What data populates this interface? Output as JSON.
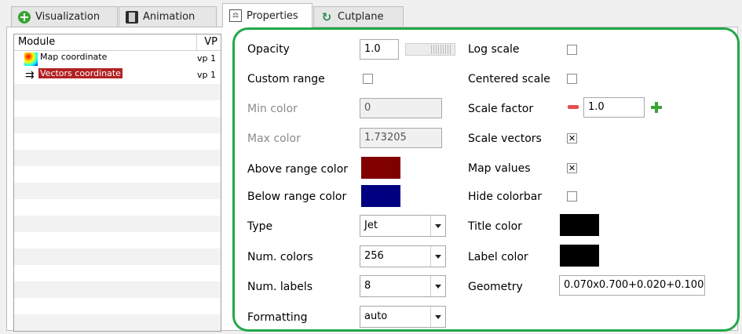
{
  "tabs": [
    {
      "label": "Visualization",
      "icon": "plus-circle-icon"
    },
    {
      "label": "Animation",
      "icon": "film-icon"
    },
    {
      "label": "Properties",
      "icon": "properties-icon"
    },
    {
      "label": "Cutplane",
      "icon": "cutplane-icon"
    }
  ],
  "modules": {
    "header": {
      "module": "Module",
      "vp": "VP"
    },
    "items": [
      {
        "label": "Map coordinate",
        "vp": "vp 1",
        "icon": "colormap-icon",
        "selected": false
      },
      {
        "label": "Vectors coordinate",
        "vp": "vp 1",
        "icon": "vectors-icon",
        "selected": true
      }
    ]
  },
  "props": {
    "opacity": {
      "label": "Opacity",
      "value": "1.0"
    },
    "custom_range": {
      "label": "Custom range",
      "checked": false
    },
    "min_color": {
      "label": "Min color",
      "value": "0"
    },
    "max_color": {
      "label": "Max color",
      "value": "1.73205"
    },
    "above_range_color": {
      "label": "Above range color",
      "color": "#800000"
    },
    "below_range_color": {
      "label": "Below range color",
      "color": "#000080"
    },
    "type": {
      "label": "Type",
      "value": "Jet"
    },
    "num_colors": {
      "label": "Num. colors",
      "value": "256"
    },
    "num_labels": {
      "label": "Num. labels",
      "value": "8"
    },
    "formatting": {
      "label": "Formatting",
      "value": "auto"
    },
    "log_scale": {
      "label": "Log scale",
      "checked": false
    },
    "centered_scale": {
      "label": "Centered scale",
      "checked": false
    },
    "scale_factor": {
      "label": "Scale factor",
      "value": "1.0"
    },
    "scale_vectors": {
      "label": "Scale vectors",
      "checked": true,
      "mark": "✕"
    },
    "map_values": {
      "label": "Map values",
      "checked": true,
      "mark": "✕"
    },
    "hide_colorbar": {
      "label": "Hide colorbar",
      "checked": false
    },
    "title_color": {
      "label": "Title color",
      "color": "#000000"
    },
    "label_color": {
      "label": "Label color",
      "color": "#000000"
    },
    "geometry": {
      "label": "Geometry",
      "value": "0.070x0.700+0.020+0.100"
    }
  },
  "colors": {
    "accent_outline": "#22a84a",
    "selection": "#b22222"
  }
}
